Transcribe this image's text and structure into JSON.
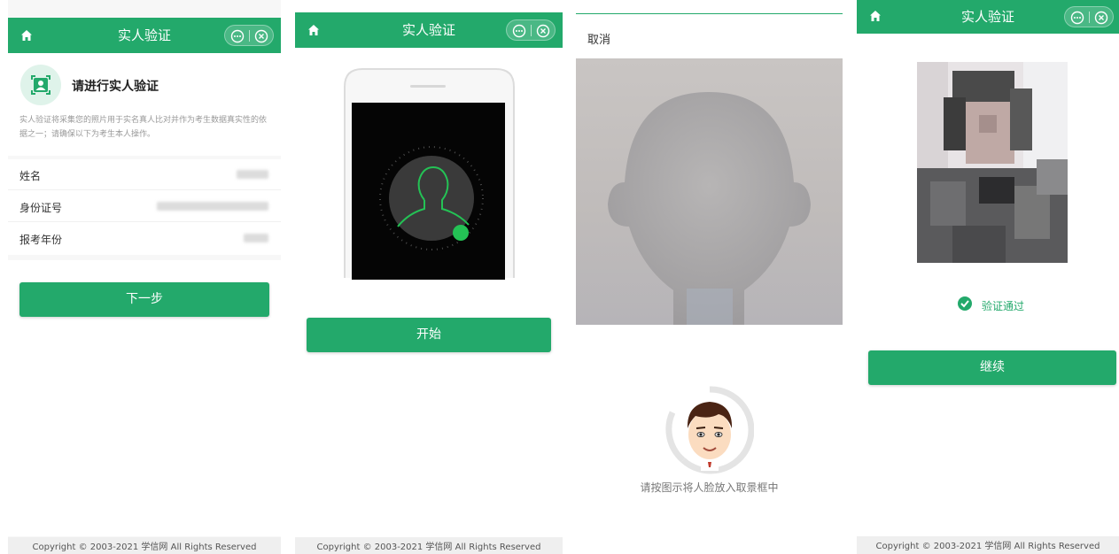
{
  "screen1": {
    "header_title": "实人验证",
    "heading": "请进行实人验证",
    "description": "实人验证将采集您的照片用于实名真人比对并作为考生数据真实性的依据之一；请确保以下为考生本人操作。",
    "fields": [
      {
        "label": "姓名"
      },
      {
        "label": "身份证号"
      },
      {
        "label": "报考年份"
      }
    ],
    "next_button": "下一步",
    "footer": "Copyright © 2003-2021 学信网 All Rights Reserved"
  },
  "screen2": {
    "header_title": "实人验证",
    "start_button": "开始",
    "footer": "Copyright © 2003-2021 学信网 All Rights Reserved"
  },
  "screen3": {
    "cancel": "取消",
    "instruction": "请按图示将人脸放入取景框中"
  },
  "screen4": {
    "header_title": "实人验证",
    "status": "验证通过",
    "continue_button": "继续",
    "footer": "Copyright © 2003-2021 学信网 All Rights Reserved"
  },
  "colors": {
    "brand": "#23a96b",
    "success": "#23a96b",
    "footer_bg": "#efefef"
  },
  "icons": [
    "home-icon",
    "more-icon",
    "close-circle-icon",
    "face-scan-icon",
    "check-circle-icon"
  ]
}
